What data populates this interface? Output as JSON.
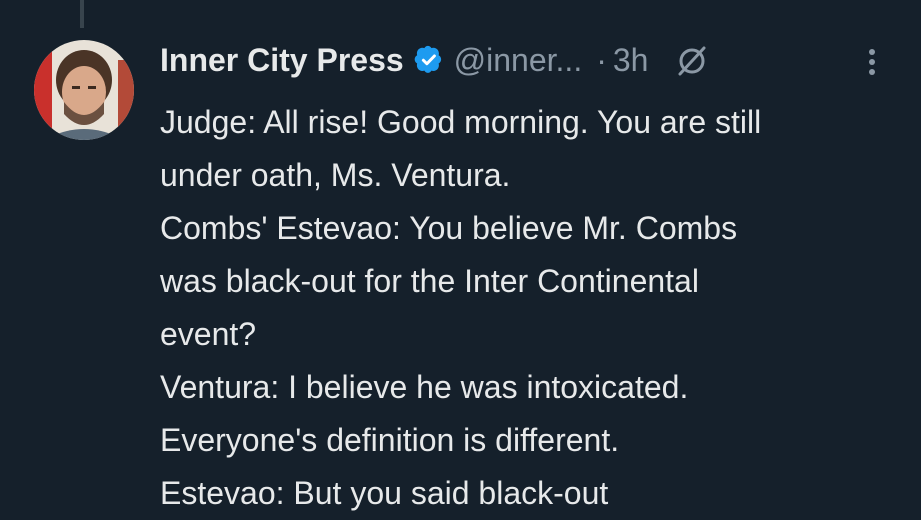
{
  "tweet": {
    "author_name": "Inner City Press",
    "handle": "@inner...",
    "separator": "·",
    "time": "3h",
    "lines": [
      "Judge: All rise! Good morning. You are still",
      "under oath, Ms. Ventura.",
      "Combs' Estevao: You believe Mr. Combs",
      "was black-out for the Inter Continental",
      "event?",
      "Ventura: I believe he was intoxicated.",
      "Everyone's definition is different.",
      "Estevao: But you said black-out"
    ]
  },
  "icons": {
    "verified": "verified-badge-icon",
    "grok": "grok-icon",
    "more": "more-options-icon"
  },
  "colors": {
    "background": "#15202b",
    "primary_text": "#e7e9ea",
    "secondary_text": "#8b98a5",
    "verified_blue": "#1d9bf0"
  }
}
